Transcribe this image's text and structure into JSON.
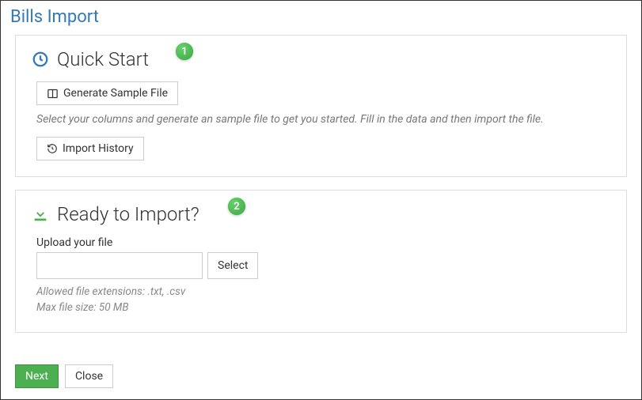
{
  "page_title": "Bills Import",
  "quick_start": {
    "badge": "1",
    "title": "Quick Start",
    "generate_btn": "Generate Sample File",
    "helper_text": "Select your columns and generate an sample file to get you started. Fill in the data and then import the file.",
    "history_btn": "Import History"
  },
  "ready_import": {
    "badge": "2",
    "title": "Ready to Import?",
    "upload_label": "Upload your file",
    "select_btn": "Select",
    "ext_hint": "Allowed file extensions: .txt, .csv",
    "size_hint": "Max file size: 50 MB"
  },
  "footer": {
    "next": "Next",
    "close": "Close"
  }
}
